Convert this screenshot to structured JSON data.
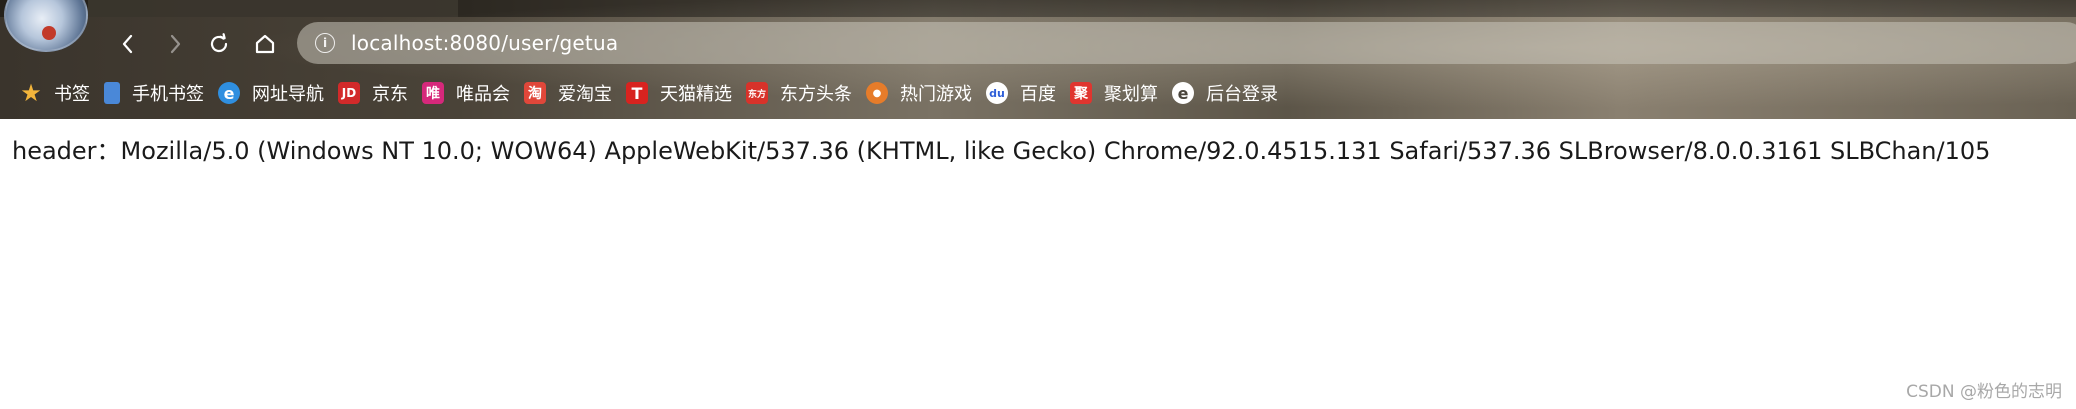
{
  "browser": {
    "address_bar": {
      "url": "localhost:8080/user/getua"
    },
    "bookmarks": [
      {
        "label": "书签",
        "icon": "star-icon",
        "color": "#f3b53b",
        "glyph": "★"
      },
      {
        "label": "手机书签",
        "icon": "phone-bookmark-icon",
        "color": "#4a88d8",
        "glyph": "▯"
      },
      {
        "label": "网址导航",
        "icon": "ie-e-icon",
        "color": "#2f8fe0",
        "glyph": "e"
      },
      {
        "label": "京东",
        "icon": "jd-logo-icon",
        "color": "#d22a2a",
        "glyph": "JD"
      },
      {
        "label": "唯品会",
        "icon": "vip-logo-icon",
        "color": "#d6287b",
        "glyph": "唯"
      },
      {
        "label": "爱淘宝",
        "icon": "taobao-logo-icon",
        "color": "#e0473a",
        "glyph": "淘"
      },
      {
        "label": "天猫精选",
        "icon": "tmall-logo-icon",
        "color": "#d8231f",
        "glyph": "T"
      },
      {
        "label": "东方头条",
        "icon": "dftt-logo-icon",
        "color": "#d8322a",
        "glyph": "东方"
      },
      {
        "label": "热门游戏",
        "icon": "games-icon",
        "color": "#e67c2a",
        "glyph": "●"
      },
      {
        "label": "百度",
        "icon": "baidu-paw-icon",
        "color": "#2f5fd8",
        "glyph": "du"
      },
      {
        "label": "聚划算",
        "icon": "juhuasuan-logo-icon",
        "color": "#e0352f",
        "glyph": "聚"
      },
      {
        "label": "后台登录",
        "icon": "e-logo-icon",
        "color": "#ffffff",
        "glyph": "e"
      }
    ]
  },
  "page": {
    "text": "header：Mozilla/5.0 (Windows NT 10.0; WOW64) AppleWebKit/537.36 (KHTML, like Gecko) Chrome/92.0.4515.131 Safari/537.36 SLBrowser/8.0.0.3161 SLBChan/105"
  },
  "watermark": "CSDN @粉色的志明"
}
